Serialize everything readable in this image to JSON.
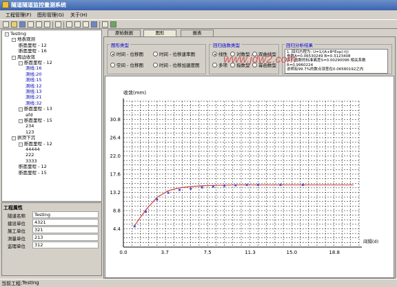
{
  "window": {
    "title": "隧道隧道监控量测系统"
  },
  "menu": [
    {
      "label": "工程管理(F)"
    },
    {
      "label": "图形管理(G)"
    },
    {
      "label": "关于(H)"
    }
  ],
  "tree": {
    "nodes": [
      {
        "label": "TestIng",
        "toggle": "-"
      },
      {
        "label": "地表观测",
        "toggle": "-"
      },
      {
        "label": "断面里程 - 12",
        "toggle": ""
      },
      {
        "label": "断面里程 - 16",
        "toggle": ""
      },
      {
        "label": "周边收敛",
        "toggle": "-"
      },
      {
        "label": "断面里程 - 12",
        "toggle": "-"
      },
      {
        "label": "测线:16",
        "toggle": ""
      },
      {
        "label": "测线:20",
        "toggle": ""
      },
      {
        "label": "测线:15",
        "toggle": ""
      },
      {
        "label": "测线:12",
        "toggle": ""
      },
      {
        "label": "测线:13",
        "toggle": ""
      },
      {
        "label": "测线:21",
        "toggle": ""
      },
      {
        "label": "测线:32",
        "toggle": ""
      },
      {
        "label": "断面里程 - 13",
        "toggle": "-"
      },
      {
        "label": "afd",
        "toggle": ""
      },
      {
        "label": "断面里程 - 15",
        "toggle": "-"
      },
      {
        "label": "234",
        "toggle": ""
      },
      {
        "label": "123",
        "toggle": ""
      },
      {
        "label": "拱顶下沉",
        "toggle": "-"
      },
      {
        "label": "断面里程 - 12",
        "toggle": "-"
      },
      {
        "label": "44444",
        "toggle": ""
      },
      {
        "label": "222",
        "toggle": ""
      },
      {
        "label": "3333",
        "toggle": ""
      },
      {
        "label": "断面里程 - 12",
        "toggle": ""
      },
      {
        "label": "断面里程 - 15",
        "toggle": ""
      }
    ]
  },
  "properties": {
    "title": "工程属性",
    "rows": [
      {
        "label": "隧道名称",
        "value": "TestIng"
      },
      {
        "label": "建设单位",
        "value": "4321"
      },
      {
        "label": "施工单位",
        "value": "321"
      },
      {
        "label": "测量单位",
        "value": "213"
      },
      {
        "label": "监理单位",
        "value": "312"
      }
    ]
  },
  "tabs": [
    {
      "label": "原始数据"
    },
    {
      "label": "图形"
    },
    {
      "label": "报表"
    }
  ],
  "chart_type_group": {
    "title": "图形类型",
    "options": [
      {
        "label": "时间 - 位移图",
        "selected": true
      },
      {
        "label": "时间 - 位移速率图",
        "selected": false
      },
      {
        "label": "空间 - 位移图",
        "selected": false
      },
      {
        "label": "时间 - 位移加速度图",
        "selected": false
      }
    ]
  },
  "regression_group": {
    "title": "回归函数类型",
    "options": [
      {
        "label": "线性",
        "selected": true
      },
      {
        "label": "对数型",
        "selected": false
      },
      {
        "label": "双曲线型",
        "selected": false
      },
      {
        "label": "多项",
        "selected": false
      },
      {
        "label": "指数型",
        "selected": false
      },
      {
        "label": "幂函数型",
        "selected": false
      }
    ]
  },
  "result_group": {
    "title": "回归分析结果",
    "lines": [
      "1. 回归方程为: U=1/(A+B*Exp(-t))",
      "   参数A=0.06530249  B=0.3123408",
      "   回归函数的标准离差S=0.00290096    相关系数",
      "   R=0.9960224",
      "   说明有99.7%的数点误差在0.06580192之内"
    ]
  },
  "watermark": "www.jdw2.com",
  "chart_data": {
    "type": "scatter",
    "ylabel": "收敛(mm)",
    "xlabel": "间隔(d)",
    "x_ticks": [
      "0.0",
      "3.7",
      "7.5",
      "11.3",
      "15.0",
      "18.8"
    ],
    "y_ticks": [
      "4.4",
      "8.8",
      "13.2",
      "17.6",
      "22.0",
      "26.4",
      "30.8"
    ],
    "xlim": [
      0,
      21.0
    ],
    "ylim": [
      0,
      35.2
    ],
    "grid": true,
    "points": [
      {
        "x": 1.0,
        "y": 5.0
      },
      {
        "x": 2.0,
        "y": 8.5
      },
      {
        "x": 3.0,
        "y": 11.5
      },
      {
        "x": 4.0,
        "y": 13.1
      },
      {
        "x": 5.0,
        "y": 13.8
      },
      {
        "x": 6.0,
        "y": 14.1
      },
      {
        "x": 7.0,
        "y": 14.4
      },
      {
        "x": 8.0,
        "y": 14.6
      },
      {
        "x": 9.0,
        "y": 14.8
      },
      {
        "x": 10.0,
        "y": 14.9
      },
      {
        "x": 11.0,
        "y": 15.0
      },
      {
        "x": 12.0,
        "y": 15.0
      },
      {
        "x": 14.0,
        "y": 15.0
      },
      {
        "x": 16.0,
        "y": 15.0
      }
    ],
    "fit_curve": [
      {
        "x": 1.0,
        "y": 5.2
      },
      {
        "x": 2.0,
        "y": 9.0
      },
      {
        "x": 3.0,
        "y": 12.0
      },
      {
        "x": 4.0,
        "y": 13.6
      },
      {
        "x": 5.0,
        "y": 14.3
      },
      {
        "x": 6.0,
        "y": 14.6
      },
      {
        "x": 7.0,
        "y": 14.8
      },
      {
        "x": 8.0,
        "y": 14.9
      },
      {
        "x": 10.0,
        "y": 15.0
      },
      {
        "x": 14.0,
        "y": 15.0
      },
      {
        "x": 20.5,
        "y": 15.0
      }
    ],
    "colors": {
      "points": "#5050d0",
      "fit": "#d04040",
      "grid": "#000000"
    }
  },
  "status": {
    "label": "当前工程:",
    "value": "TestIng"
  }
}
